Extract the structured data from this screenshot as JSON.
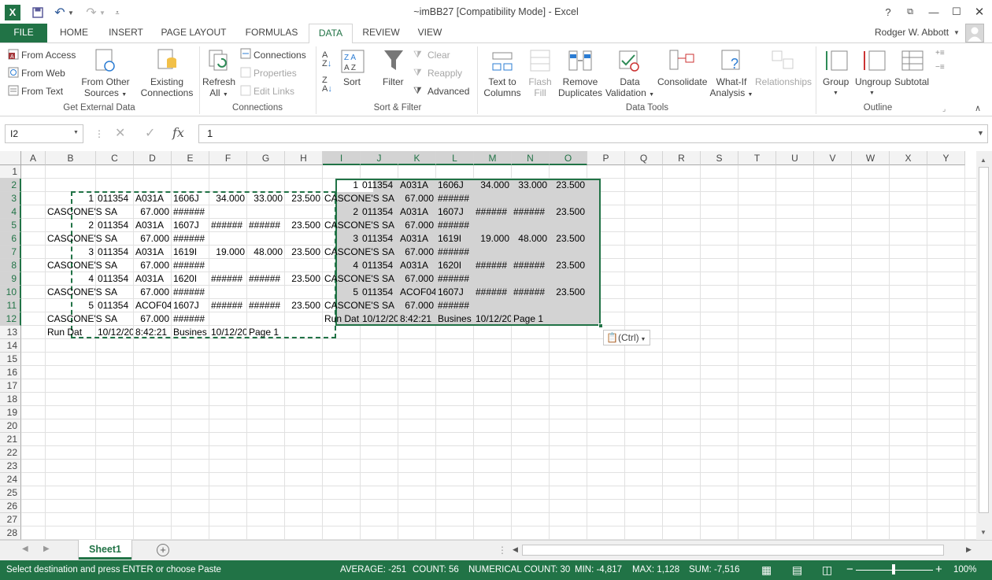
{
  "window": {
    "title": "~imBB27  [Compatibility Mode] - Excel",
    "help": "?",
    "user": "Rodger W. Abbott"
  },
  "tabs": [
    "FILE",
    "HOME",
    "INSERT",
    "PAGE LAYOUT",
    "FORMULAS",
    "DATA",
    "REVIEW",
    "VIEW"
  ],
  "active_tab": "DATA",
  "ribbon": {
    "get_external": {
      "from_access": "From Access",
      "from_web": "From Web",
      "from_text": "From Text",
      "from_other_1": "From Other",
      "from_other_2": "Sources",
      "existing_1": "Existing",
      "existing_2": "Connections",
      "group": "Get External Data"
    },
    "connections": {
      "refresh_1": "Refresh",
      "refresh_2": "All",
      "connections": "Connections",
      "properties": "Properties",
      "edit_links": "Edit Links",
      "group": "Connections"
    },
    "sort_filter": {
      "sort": "Sort",
      "filter": "Filter",
      "clear": "Clear",
      "reapply": "Reapply",
      "advanced": "Advanced",
      "group": "Sort & Filter"
    },
    "data_tools": {
      "ttc_1": "Text to",
      "ttc_2": "Columns",
      "flash_1": "Flash",
      "flash_2": "Fill",
      "remove_1": "Remove",
      "remove_2": "Duplicates",
      "valid_1": "Data",
      "valid_2": "Validation",
      "consolidate": "Consolidate",
      "whatif_1": "What-If",
      "whatif_2": "Analysis",
      "relationships": "Relationships",
      "group": "Data Tools"
    },
    "outline": {
      "group_btn": "Group",
      "ungroup": "Ungroup",
      "subtotal": "Subtotal",
      "group": "Outline"
    }
  },
  "formula_bar": {
    "name_box": "I2",
    "fx": "fx",
    "value": "1"
  },
  "columns": [
    "A",
    "B",
    "C",
    "D",
    "E",
    "F",
    "G",
    "H",
    "I",
    "J",
    "K",
    "L",
    "M",
    "N",
    "O",
    "P",
    "Q",
    "R",
    "S",
    "T",
    "U",
    "V",
    "W",
    "X",
    "Y"
  ],
  "rows": [
    "1",
    "2",
    "3",
    "4",
    "5",
    "6",
    "7",
    "8",
    "9",
    "10",
    "11",
    "12",
    "13",
    "14",
    "15",
    "16",
    "17",
    "18",
    "19",
    "20",
    "21",
    "22",
    "23",
    "24",
    "25",
    "26",
    "27",
    "28"
  ],
  "cells": [
    {
      "r": 3,
      "c": "B",
      "v": "1",
      "a": "r"
    },
    {
      "r": 3,
      "c": "C",
      "v": "011354"
    },
    {
      "r": 3,
      "c": "D",
      "v": "A031A"
    },
    {
      "r": 3,
      "c": "E",
      "v": "1606J"
    },
    {
      "r": 3,
      "c": "F",
      "v": "34.000",
      "a": "r"
    },
    {
      "r": 3,
      "c": "G",
      "v": "33.000",
      "a": "r"
    },
    {
      "r": 3,
      "c": "H",
      "v": "23.500",
      "a": "r"
    },
    {
      "r": 4,
      "c": "B",
      "v": "CASCONE'S SA"
    },
    {
      "r": 4,
      "c": "D",
      "v": "67.000",
      "a": "r"
    },
    {
      "r": 4,
      "c": "E",
      "v": "######"
    },
    {
      "r": 5,
      "c": "B",
      "v": "2",
      "a": "r"
    },
    {
      "r": 5,
      "c": "C",
      "v": "011354"
    },
    {
      "r": 5,
      "c": "D",
      "v": "A031A"
    },
    {
      "r": 5,
      "c": "E",
      "v": "1607J"
    },
    {
      "r": 5,
      "c": "F",
      "v": "######"
    },
    {
      "r": 5,
      "c": "G",
      "v": "######"
    },
    {
      "r": 5,
      "c": "H",
      "v": "23.500",
      "a": "r"
    },
    {
      "r": 6,
      "c": "B",
      "v": "CASCONE'S SA"
    },
    {
      "r": 6,
      "c": "D",
      "v": "67.000",
      "a": "r"
    },
    {
      "r": 6,
      "c": "E",
      "v": "######"
    },
    {
      "r": 7,
      "c": "B",
      "v": "3",
      "a": "r"
    },
    {
      "r": 7,
      "c": "C",
      "v": "011354"
    },
    {
      "r": 7,
      "c": "D",
      "v": "A031A"
    },
    {
      "r": 7,
      "c": "E",
      "v": "1619I"
    },
    {
      "r": 7,
      "c": "F",
      "v": "19.000",
      "a": "r"
    },
    {
      "r": 7,
      "c": "G",
      "v": "48.000",
      "a": "r"
    },
    {
      "r": 7,
      "c": "H",
      "v": "23.500",
      "a": "r"
    },
    {
      "r": 8,
      "c": "B",
      "v": "CASCONE'S SA"
    },
    {
      "r": 8,
      "c": "D",
      "v": "67.000",
      "a": "r"
    },
    {
      "r": 8,
      "c": "E",
      "v": "######"
    },
    {
      "r": 9,
      "c": "B",
      "v": "4",
      "a": "r"
    },
    {
      "r": 9,
      "c": "C",
      "v": "011354"
    },
    {
      "r": 9,
      "c": "D",
      "v": "A031A"
    },
    {
      "r": 9,
      "c": "E",
      "v": "1620I"
    },
    {
      "r": 9,
      "c": "F",
      "v": "######"
    },
    {
      "r": 9,
      "c": "G",
      "v": "######"
    },
    {
      "r": 9,
      "c": "H",
      "v": "23.500",
      "a": "r"
    },
    {
      "r": 10,
      "c": "B",
      "v": "CASCONE'S SA"
    },
    {
      "r": 10,
      "c": "D",
      "v": "67.000",
      "a": "r"
    },
    {
      "r": 10,
      "c": "E",
      "v": "######"
    },
    {
      "r": 11,
      "c": "B",
      "v": "5",
      "a": "r"
    },
    {
      "r": 11,
      "c": "C",
      "v": "011354"
    },
    {
      "r": 11,
      "c": "D",
      "v": "ACOF04"
    },
    {
      "r": 11,
      "c": "E",
      "v": "1607J"
    },
    {
      "r": 11,
      "c": "F",
      "v": "######"
    },
    {
      "r": 11,
      "c": "G",
      "v": "######"
    },
    {
      "r": 11,
      "c": "H",
      "v": "23.500",
      "a": "r"
    },
    {
      "r": 12,
      "c": "B",
      "v": "CASCONE'S SA"
    },
    {
      "r": 12,
      "c": "D",
      "v": "67.000",
      "a": "r"
    },
    {
      "r": 12,
      "c": "E",
      "v": "######"
    },
    {
      "r": 13,
      "c": "B",
      "v": "Run Dat"
    },
    {
      "r": 13,
      "c": "C",
      "v": "10/12/20"
    },
    {
      "r": 13,
      "c": "D",
      "v": "8:42:21"
    },
    {
      "r": 13,
      "c": "E",
      "v": "Busines"
    },
    {
      "r": 13,
      "c": "F",
      "v": "10/12/20"
    },
    {
      "r": 13,
      "c": "G",
      "v": "Page   1"
    },
    {
      "r": 2,
      "c": "I",
      "v": "1",
      "a": "r"
    },
    {
      "r": 2,
      "c": "J",
      "v": "011354"
    },
    {
      "r": 2,
      "c": "K",
      "v": "A031A"
    },
    {
      "r": 2,
      "c": "L",
      "v": "1606J"
    },
    {
      "r": 2,
      "c": "M",
      "v": "34.000",
      "a": "r"
    },
    {
      "r": 2,
      "c": "N",
      "v": "33.000",
      "a": "r"
    },
    {
      "r": 2,
      "c": "O",
      "v": "23.500",
      "a": "r"
    },
    {
      "r": 3,
      "c": "I",
      "v": "CASCONE'S SA"
    },
    {
      "r": 3,
      "c": "K",
      "v": "67.000",
      "a": "r"
    },
    {
      "r": 3,
      "c": "L",
      "v": "######"
    },
    {
      "r": 4,
      "c": "I",
      "v": "2",
      "a": "r"
    },
    {
      "r": 4,
      "c": "J",
      "v": "011354"
    },
    {
      "r": 4,
      "c": "K",
      "v": "A031A"
    },
    {
      "r": 4,
      "c": "L",
      "v": "1607J"
    },
    {
      "r": 4,
      "c": "M",
      "v": "######"
    },
    {
      "r": 4,
      "c": "N",
      "v": "######"
    },
    {
      "r": 4,
      "c": "O",
      "v": "23.500",
      "a": "r"
    },
    {
      "r": 5,
      "c": "I",
      "v": "CASCONE'S SA"
    },
    {
      "r": 5,
      "c": "K",
      "v": "67.000",
      "a": "r"
    },
    {
      "r": 5,
      "c": "L",
      "v": "######"
    },
    {
      "r": 6,
      "c": "I",
      "v": "3",
      "a": "r"
    },
    {
      "r": 6,
      "c": "J",
      "v": "011354"
    },
    {
      "r": 6,
      "c": "K",
      "v": "A031A"
    },
    {
      "r": 6,
      "c": "L",
      "v": "1619I"
    },
    {
      "r": 6,
      "c": "M",
      "v": "19.000",
      "a": "r"
    },
    {
      "r": 6,
      "c": "N",
      "v": "48.000",
      "a": "r"
    },
    {
      "r": 6,
      "c": "O",
      "v": "23.500",
      "a": "r"
    },
    {
      "r": 7,
      "c": "I",
      "v": "CASCONE'S SA"
    },
    {
      "r": 7,
      "c": "K",
      "v": "67.000",
      "a": "r"
    },
    {
      "r": 7,
      "c": "L",
      "v": "######"
    },
    {
      "r": 8,
      "c": "I",
      "v": "4",
      "a": "r"
    },
    {
      "r": 8,
      "c": "J",
      "v": "011354"
    },
    {
      "r": 8,
      "c": "K",
      "v": "A031A"
    },
    {
      "r": 8,
      "c": "L",
      "v": "1620I"
    },
    {
      "r": 8,
      "c": "M",
      "v": "######"
    },
    {
      "r": 8,
      "c": "N",
      "v": "######"
    },
    {
      "r": 8,
      "c": "O",
      "v": "23.500",
      "a": "r"
    },
    {
      "r": 9,
      "c": "I",
      "v": "CASCONE'S SA"
    },
    {
      "r": 9,
      "c": "K",
      "v": "67.000",
      "a": "r"
    },
    {
      "r": 9,
      "c": "L",
      "v": "######"
    },
    {
      "r": 10,
      "c": "I",
      "v": "5",
      "a": "r"
    },
    {
      "r": 10,
      "c": "J",
      "v": "011354"
    },
    {
      "r": 10,
      "c": "K",
      "v": "ACOF04"
    },
    {
      "r": 10,
      "c": "L",
      "v": "1607J"
    },
    {
      "r": 10,
      "c": "M",
      "v": "######"
    },
    {
      "r": 10,
      "c": "N",
      "v": "######"
    },
    {
      "r": 10,
      "c": "O",
      "v": "23.500",
      "a": "r"
    },
    {
      "r": 11,
      "c": "I",
      "v": "CASCONE'S SA"
    },
    {
      "r": 11,
      "c": "K",
      "v": "67.000",
      "a": "r"
    },
    {
      "r": 11,
      "c": "L",
      "v": "######"
    },
    {
      "r": 12,
      "c": "I",
      "v": "Run Dat"
    },
    {
      "r": 12,
      "c": "J",
      "v": "10/12/20"
    },
    {
      "r": 12,
      "c": "K",
      "v": "8:42:21"
    },
    {
      "r": 12,
      "c": "L",
      "v": "Busines"
    },
    {
      "r": 12,
      "c": "M",
      "v": "10/12/20"
    },
    {
      "r": 12,
      "c": "N",
      "v": "Page   1"
    }
  ],
  "paste_options": "(Ctrl)",
  "sheet_tab": "Sheet1",
  "status": {
    "message": "Select destination and press ENTER or choose Paste",
    "average": "AVERAGE: -251",
    "count": "COUNT: 56",
    "numcount": "NUMERICAL COUNT: 30",
    "min": "MIN: -4,817",
    "max": "MAX: 1,128",
    "sum": "SUM: -7,516",
    "zoom": "100%"
  },
  "colors": {
    "accent": "#217346",
    "selection_fill": "#d3d3d3"
  }
}
